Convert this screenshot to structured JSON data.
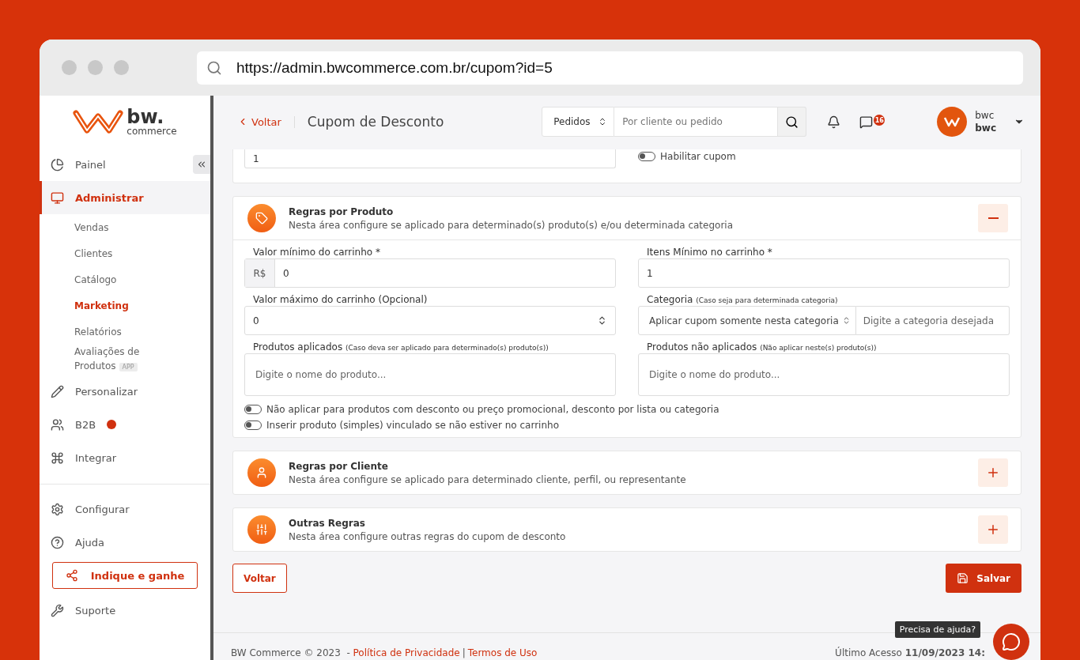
{
  "browser": {
    "url": "https://admin.bwcommerce.com.br/cupom?id=5"
  },
  "logo": {
    "name": "bw.",
    "tagline": "commerce"
  },
  "sidebar": {
    "items": [
      {
        "label": "Painel",
        "selected": false
      },
      {
        "label": "Administrar",
        "selected": true,
        "children": [
          {
            "label": "Vendas",
            "selected": false
          },
          {
            "label": "Clientes",
            "selected": false
          },
          {
            "label": "Catálogo",
            "selected": false
          },
          {
            "label": "Marketing",
            "selected": true
          },
          {
            "label": "Relatórios",
            "selected": false
          },
          {
            "label": "Avaliações de Produtos",
            "badge": "APP",
            "selected": false
          }
        ]
      },
      {
        "label": "Personalizar",
        "selected": false
      },
      {
        "label": "B2B",
        "selected": false,
        "dot": true
      },
      {
        "label": "Integrar",
        "selected": false
      },
      {
        "label": "Configurar",
        "selected": false
      },
      {
        "label": "Ajuda",
        "selected": false
      }
    ],
    "invite_button": "Indique e ganhe",
    "support": "Suporte"
  },
  "header": {
    "back": "Voltar",
    "title": "Cupom de Desconto",
    "search_scope": "Pedidos",
    "search_placeholder": "Por cliente ou pedido",
    "messages_count": "16",
    "user_name": "bwc",
    "user_account": "bwc"
  },
  "top_card": {
    "value": "1",
    "toggle": {
      "label": "Habilitar cupom",
      "on": false
    }
  },
  "sections": [
    {
      "title": "Regras por Produto",
      "description": "Nesta área configure se aplicado para determinado(s) produto(s) e/ou determinada categoria",
      "expanded": true,
      "fields": [
        {
          "kind": "money",
          "label": "Valor mínimo do carrinho *",
          "prefix": "R$",
          "value": "0"
        },
        {
          "kind": "text",
          "label": "Itens Mínimo no carrinho *",
          "value": "1"
        },
        {
          "kind": "number",
          "label": "Valor máximo do carrinho (Opcional)",
          "value": "0"
        },
        {
          "kind": "category",
          "label": "Categoria",
          "hint": "(Caso seja para determinada categoria)",
          "select": "Aplicar cupom somente nesta categoria",
          "placeholder": "Digite a categoria desejada"
        },
        {
          "kind": "tags",
          "label": "Produtos aplicados",
          "hint": "(Caso deva ser aplicado para determinado(s) produto(s))",
          "placeholder": "Digite o nome do produto..."
        },
        {
          "kind": "tags",
          "label": "Produtos não aplicados",
          "hint": "(Não aplicar neste(s) produto(s))",
          "placeholder": "Digite o nome do produto..."
        }
      ],
      "toggles": [
        {
          "label": "Não aplicar para produtos com desconto ou preço promocional, desconto por lista ou categoria",
          "on": false
        },
        {
          "label": "Inserir produto (simples) vinculado se não estiver no carrinho",
          "on": false
        }
      ]
    },
    {
      "title": "Regras por Cliente",
      "description": "Nesta área configure se aplicado para determinado cliente, perfil, ou representante",
      "expanded": false
    },
    {
      "title": "Outras Regras",
      "description": "Nesta área configure outras regras do cupom de desconto",
      "expanded": false
    }
  ],
  "actions": {
    "back": "Voltar",
    "save": "Salvar"
  },
  "footer": {
    "copyright": "BW Commerce © 2023  - ",
    "privacy": "Política de Privacidade",
    "separator": "|",
    "terms": "Termos de Uso",
    "last_access": "Último Acesso **11/09/2023 14:**"
  },
  "help": {
    "tooltip": "Precisa de ajuda?"
  }
}
